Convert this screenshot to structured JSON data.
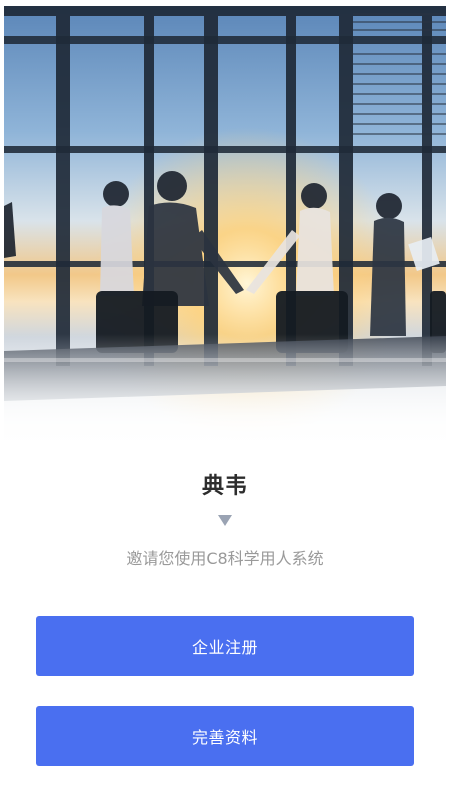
{
  "hero": {
    "image": "business-handshake-photo"
  },
  "header": {
    "title": "典韦",
    "subtitle": "邀请您使用C8科学用人系统"
  },
  "actions": {
    "register_label": "企业注册",
    "profile_label": "完善资料"
  },
  "colors": {
    "primary_button": "#4a6ff0",
    "title_text": "#2d2d2d",
    "subtitle_text": "#9a9a9a",
    "arrow": "#9aa3b3"
  }
}
